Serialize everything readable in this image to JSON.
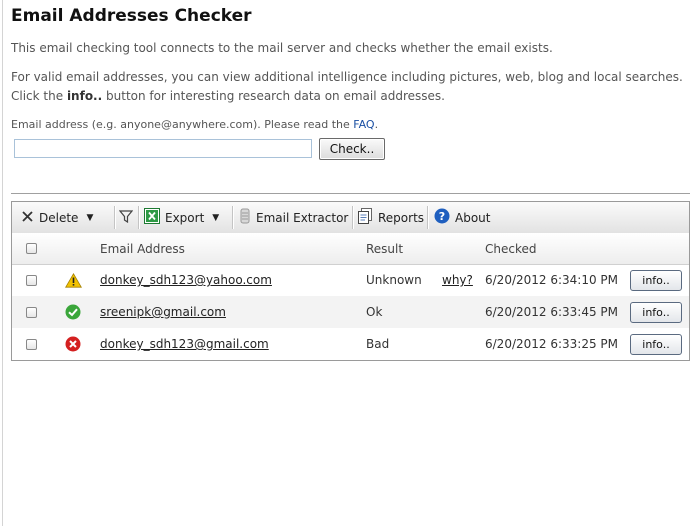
{
  "page": {
    "title": "Email Addresses Checker",
    "intro": "This email checking tool connects to the mail server and checks whether the email exists.",
    "details_line1": "For valid email addresses, you can view additional intelligence including pictures, web, blog and local searches.",
    "details_line2_pre": "Click the",
    "details_line2_bold": "info..",
    "details_line2_post": "button for interesting research data on email addresses.",
    "hint_text": "Email address (e.g. anyone@anywhere.com). Please read the",
    "hint_link": "FAQ",
    "hint_suffix": "."
  },
  "form": {
    "email_value": "",
    "check_label": "Check.."
  },
  "toolbar": {
    "delete": "Delete",
    "export": "Export",
    "email_extractor": "Email Extractor",
    "reports": "Reports",
    "about": "About"
  },
  "columns": {
    "email": "Email Address",
    "result": "Result",
    "checked": "Checked"
  },
  "rows": [
    {
      "status_icon": "warning-icon",
      "email": "donkey_sdh123@yahoo.com",
      "result": "Unknown",
      "why": "why?",
      "checked": "6/20/2012 6:34:10 PM",
      "info": "info.."
    },
    {
      "status_icon": "ok-check-icon",
      "email": "sreenipk@gmail.com",
      "result": "Ok",
      "why": "",
      "checked": "6/20/2012 6:33:45 PM",
      "info": "info.."
    },
    {
      "status_icon": "error-x-icon",
      "email": "donkey_sdh123@gmail.com",
      "result": "Bad",
      "why": "",
      "checked": "6/20/2012 6:33:25 PM",
      "info": "info.."
    }
  ],
  "colors": {
    "link": "#1a4fa3",
    "warning": "#f2c200",
    "ok": "#3aa63a",
    "bad": "#d42020",
    "about": "#1f5fbf"
  }
}
